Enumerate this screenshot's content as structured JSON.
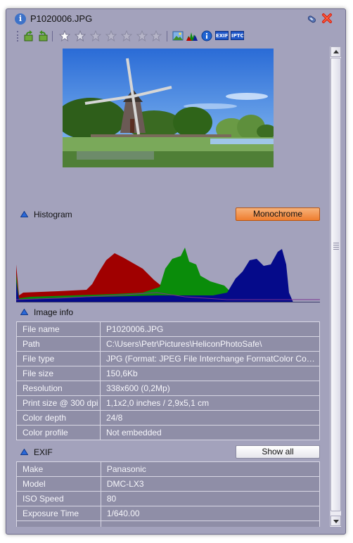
{
  "window": {
    "title": "P1020006.JPG"
  },
  "toolbar": {
    "icons": [
      "rotate-left-icon",
      "rotate-right-icon",
      "star-1-icon",
      "star-2-icon",
      "star-3-icon",
      "star-4-icon",
      "star-5-icon",
      "star-6-icon",
      "image-icon",
      "histogram-icon",
      "info-icon"
    ],
    "exif_badge": "EXIF",
    "iptc_badge": "IPTC"
  },
  "histogram": {
    "label": "Histogram",
    "mode_button": "Monochrome"
  },
  "image_info": {
    "label": "Image info",
    "rows": [
      {
        "key": "File name",
        "value": "P1020006.JPG"
      },
      {
        "key": "Path",
        "value": "C:\\Users\\Petr\\Pictures\\HeliconPhotoSafe\\"
      },
      {
        "key": "File type",
        "value": "JPG (Format: JPEG File Interchange FormatColor Comp..."
      },
      {
        "key": "File size",
        "value": "150,6Kb"
      },
      {
        "key": "Resolution",
        "value": "338x600 (0,2Mp)"
      },
      {
        "key": "Print size @ 300 dpi",
        "value": "1,1x2,0 inches  / 2,9x5,1 cm"
      },
      {
        "key": "Color depth",
        "value": "24/8"
      },
      {
        "key": "Color profile",
        "value": "Not embedded"
      }
    ]
  },
  "exif": {
    "label": "EXIF",
    "show_all_button": "Show all",
    "rows": [
      {
        "key": "Make",
        "value": "Panasonic"
      },
      {
        "key": "Model",
        "value": "DMC-LX3"
      },
      {
        "key": "ISO Speed",
        "value": "80"
      },
      {
        "key": "Exposure Time",
        "value": "1/640.00"
      }
    ]
  },
  "colors": {
    "panel_bg": "#a3a2bc",
    "row_bg": "#8f8ea7",
    "accent_button": "#ef7d2f",
    "histogram_red": "#a00000",
    "histogram_green": "#0a8c0a",
    "histogram_blue": "#050a8a"
  }
}
